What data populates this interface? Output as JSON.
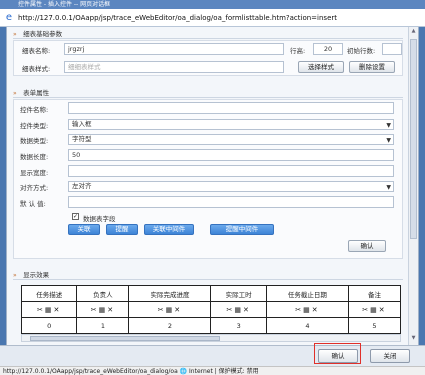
{
  "window": {
    "title": "控件属性 - 插入控件 -- 网页对话框"
  },
  "address": {
    "url": "http://127.0.0.1/OAapp/jsp/trace_eWebEditor/oa_dialog/oa_formlisttable.htm?action=insert"
  },
  "section_basic": {
    "title": "细表基础参数",
    "table_name_label": "细表名称:",
    "table_name_value": "jrgzrj",
    "rows_label": "行高:",
    "rows_value": "20",
    "init_rows_label": "初始行数:",
    "init_rows_value": "",
    "style_label": "细表样式:",
    "style_placeholder": "细细表样式",
    "select_style_button": "选择样式",
    "delete_setting_button": "删除设置"
  },
  "section_form": {
    "title": "表单属性",
    "control_name_label": "控件名称:",
    "control_name_value": "",
    "control_type_label": "控件类型:",
    "control_type_value": "输入框",
    "data_type_label": "数据类型:",
    "data_type_value": "字符型",
    "data_length_label": "数据长度:",
    "data_length_value": "50",
    "display_width_label": "显示宽度:",
    "display_width_value": "",
    "align_label": "对齐方式:",
    "align_value": "左对齐",
    "default_label": "默 认 值:",
    "default_value": "",
    "table_field_label": "数据表字段",
    "buttons": [
      "关联",
      "提醒",
      "关联中间件",
      "提醒中间件"
    ],
    "confirm_button": "确认"
  },
  "section_preview": {
    "title": "显示效果",
    "headers": [
      "任务描述",
      "负责人",
      "实际完成进度",
      "实际工时",
      "任务截止日期",
      "备注"
    ],
    "icon_cells": [
      "✂▦✕",
      "✂▦✕",
      "✂▦✕",
      "✂▦✕",
      "✂▦✕",
      "✂▦✕"
    ],
    "indexes": [
      "0",
      "1",
      "2",
      "3",
      "4",
      "5"
    ]
  },
  "footer": {
    "ok_button": "确认",
    "close_button": "关闭"
  },
  "statusbar": {
    "text": "http://127.0.0.1/OAapp/jsp/trace_eWebEditor/oa_dialog/oa  🌐 Internet | 保护模式: 禁用"
  },
  "colors": {
    "accent": "#4a8fe0",
    "highlight": "#e0302a",
    "titlebar": "#5b86c0"
  }
}
